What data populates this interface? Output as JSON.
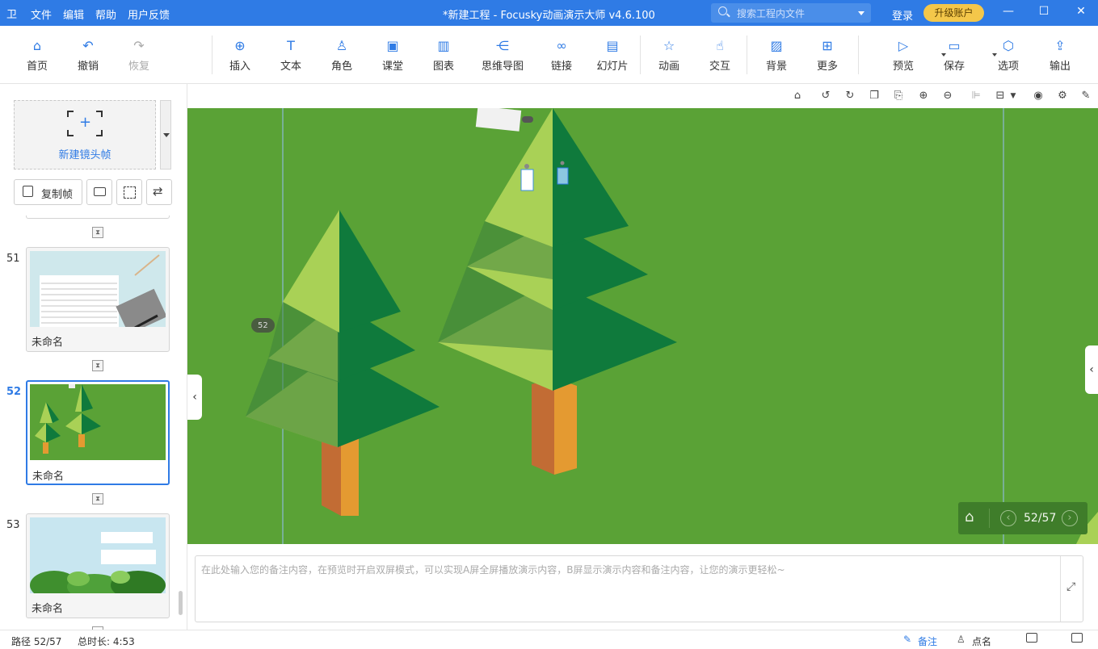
{
  "titlebar": {
    "logo_glyph": "卫",
    "menu": [
      "文件",
      "编辑",
      "帮助",
      "用户反馈"
    ],
    "title": "*新建工程 - Focusky动画演示大师  v4.6.100",
    "search_placeholder": "搜索工程内文件",
    "login": "登录",
    "upgrade": "升级账户",
    "window_controls": [
      "—",
      "☐",
      "✕"
    ]
  },
  "toolbar": {
    "items": [
      {
        "label": "首页",
        "icon": "home-icon",
        "glyph": "⌂"
      },
      {
        "label": "撤销",
        "icon": "undo-icon",
        "glyph": "↶"
      },
      {
        "label": "恢复",
        "icon": "redo-icon",
        "glyph": "↷"
      },
      {
        "label": "插入",
        "icon": "plus-circle-icon",
        "glyph": "⊕"
      },
      {
        "label": "文本",
        "icon": "text-icon",
        "glyph": "T"
      },
      {
        "label": "角色",
        "icon": "person-icon",
        "glyph": "♙"
      },
      {
        "label": "课堂",
        "icon": "classroom-icon",
        "glyph": "▣"
      },
      {
        "label": "图表",
        "icon": "bar-chart-icon",
        "glyph": "▥"
      },
      {
        "label": "思维导图",
        "icon": "mindmap-icon",
        "glyph": "⋲"
      },
      {
        "label": "链接",
        "icon": "link-icon",
        "glyph": "∞"
      },
      {
        "label": "幻灯片",
        "icon": "slides-icon",
        "glyph": "▤"
      },
      {
        "label": "动画",
        "icon": "star-icon",
        "glyph": "☆"
      },
      {
        "label": "交互",
        "icon": "hand-icon",
        "glyph": "☝"
      },
      {
        "label": "背景",
        "icon": "background-icon",
        "glyph": "▨"
      },
      {
        "label": "更多",
        "icon": "more-grid-icon",
        "glyph": "⊞"
      },
      {
        "label": "预览",
        "icon": "play-icon",
        "glyph": "▷"
      },
      {
        "label": "保存",
        "icon": "save-icon",
        "glyph": "▭"
      },
      {
        "label": "选项",
        "icon": "gear-icon",
        "glyph": "⬡"
      },
      {
        "label": "输出",
        "icon": "export-icon",
        "glyph": "⇪"
      }
    ]
  },
  "left_panel": {
    "new_frame_label": "新建镜头帧",
    "copy_frame_label": "复制帧",
    "frames": [
      {
        "number": "51",
        "name": "未命名"
      },
      {
        "number": "52",
        "name": "未命名"
      },
      {
        "number": "53",
        "name": "未命名"
      }
    ]
  },
  "stage": {
    "path_marker": "52",
    "nav_counter": "52/57"
  },
  "notes": {
    "placeholder": "在此处输入您的备注内容，在预览时开启双屏模式，可以实现A屏全屏播放演示内容，B屏显示演示内容和备注内容，让您的演示更轻松~"
  },
  "status": {
    "path": "路径 52/57",
    "duration": "总时长: 4:53",
    "notes_btn": "备注",
    "rollcall_btn": "点名"
  },
  "colors": {
    "accent": "#2f7be5",
    "stage_bg": "#5aa236",
    "tree_light": "#a9d156",
    "tree_dark": "#0f7a3c",
    "trunk_light": "#e49a31",
    "trunk_dark": "#c26c34"
  }
}
